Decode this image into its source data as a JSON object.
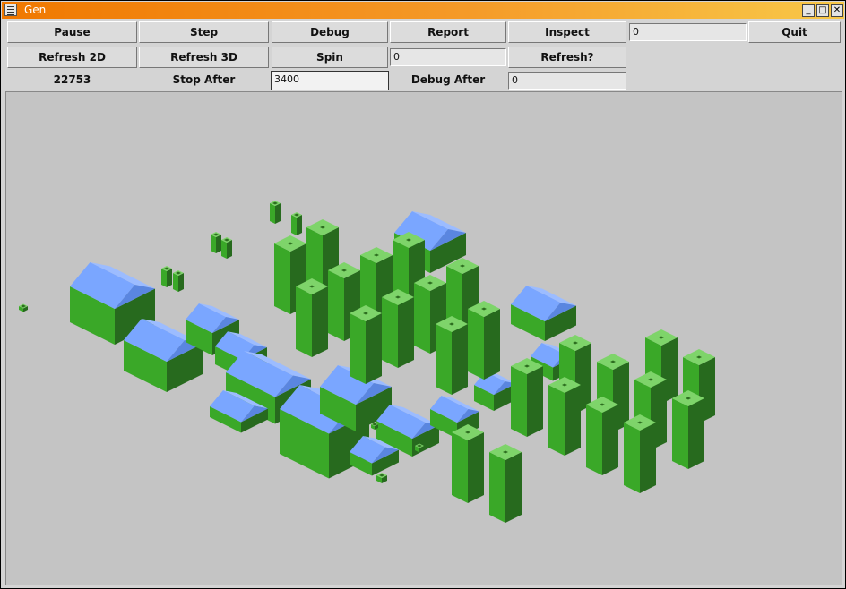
{
  "window": {
    "title": "Gen"
  },
  "toolbar": {
    "pause": "Pause",
    "step": "Step",
    "debug": "Debug",
    "report": "Report",
    "inspect": "Inspect",
    "inspect_value": "0",
    "quit": "Quit",
    "refresh2d": "Refresh 2D",
    "refresh3d": "Refresh 3D",
    "spin": "Spin",
    "spin_value": "0",
    "refresh_q": "Refresh?",
    "counter": "22753",
    "stop_after_label": "Stop After",
    "stop_after_value": "3400",
    "debug_after_label": "Debug After",
    "debug_after_value": "0"
  },
  "colors": {
    "roof": "#7aa6ff",
    "wall_light": "#3aa828",
    "wall_dark": "#276a1e",
    "tower_top": "#7ed46a",
    "background": "#c4c4c4"
  }
}
